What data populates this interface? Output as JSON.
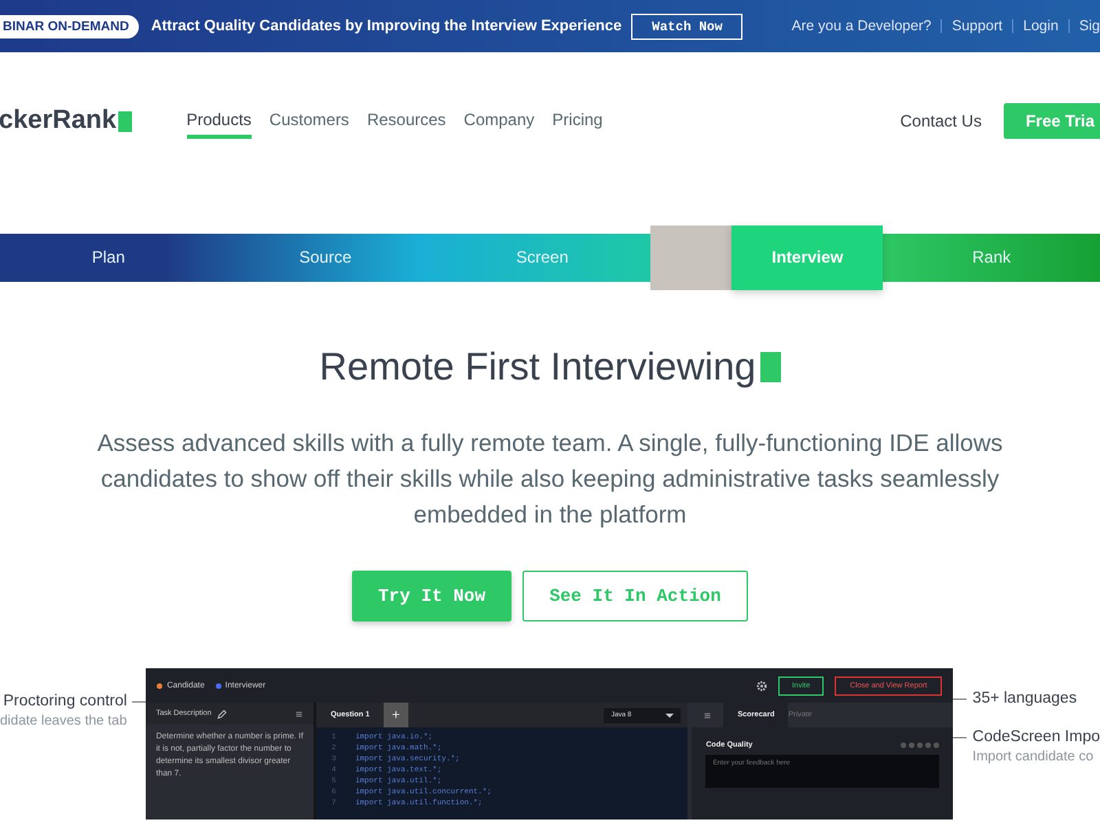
{
  "promo_bar": {
    "badge": "BINAR ON-DEMAND",
    "headline": "Attract Quality Candidates by Improving the Interview Experience",
    "button": "Watch Now",
    "links": [
      "Are you a Developer?",
      "Support",
      "Login",
      "Sig"
    ]
  },
  "nav": {
    "logo": "ckerRank",
    "items": [
      {
        "label": "Products",
        "selected": true
      },
      {
        "label": "Customers",
        "selected": false
      },
      {
        "label": "Resources",
        "selected": false
      },
      {
        "label": "Company",
        "selected": false
      },
      {
        "label": "Pricing",
        "selected": false
      }
    ],
    "contact": "Contact Us",
    "trial_button": "Free Tria"
  },
  "stages": [
    {
      "label": "Plan",
      "selected": false
    },
    {
      "label": "Source",
      "selected": false
    },
    {
      "label": "Screen",
      "selected": false
    },
    {
      "label": "Interview",
      "selected": true
    },
    {
      "label": "Rank",
      "selected": false
    }
  ],
  "hero": {
    "title": "Remote First Interviewing",
    "description": "Assess advanced skills with a fully remote team. A single, fully-functioning IDE allows candidates to show off their skills while also keeping administrative tasks seamlessly embedded in the platform",
    "primary_button": "Try It Now",
    "secondary_button": "See It In Action"
  },
  "callouts_left": [
    {
      "title": "Proctoring control",
      "subtitle": "didate leaves the tab"
    }
  ],
  "callouts_right": [
    {
      "title": "35+ languages"
    },
    {
      "title": "CodeScreen Impo",
      "subtitle": "Import candidate co"
    }
  ],
  "ide": {
    "participants": [
      {
        "label": "Candidate",
        "color": "#e8803a"
      },
      {
        "label": "Interviewer",
        "color": "#4a6cf0"
      }
    ],
    "invite_button": "Invite",
    "report_button": "Close and View Report",
    "task_title": "Task Description",
    "task_text": "Determine whether a number is prime. If it is not, partially factor the number to determine its smallest divisor greater than 7.",
    "tab": "Question 1",
    "add_tab": "+",
    "language": "Java 8",
    "code": [
      {
        "number": "1",
        "text": "import java.io.*;"
      },
      {
        "number": "2",
        "text": "import java.math.*;"
      },
      {
        "number": "3",
        "text": "import java.security.*;"
      },
      {
        "number": "4",
        "text": "import java.text.*;"
      },
      {
        "number": "5",
        "text": "import java.util.*;"
      },
      {
        "number": "6",
        "text": "import java.util.concurrent.*;"
      },
      {
        "number": "7",
        "text": "import java.util.function.*;"
      }
    ],
    "scorecard_tab": "Scorecard",
    "private_label": "Private",
    "criterion": "Code Quality",
    "stars": 0,
    "feedback_placeholder": "Enter your feedback here"
  }
}
